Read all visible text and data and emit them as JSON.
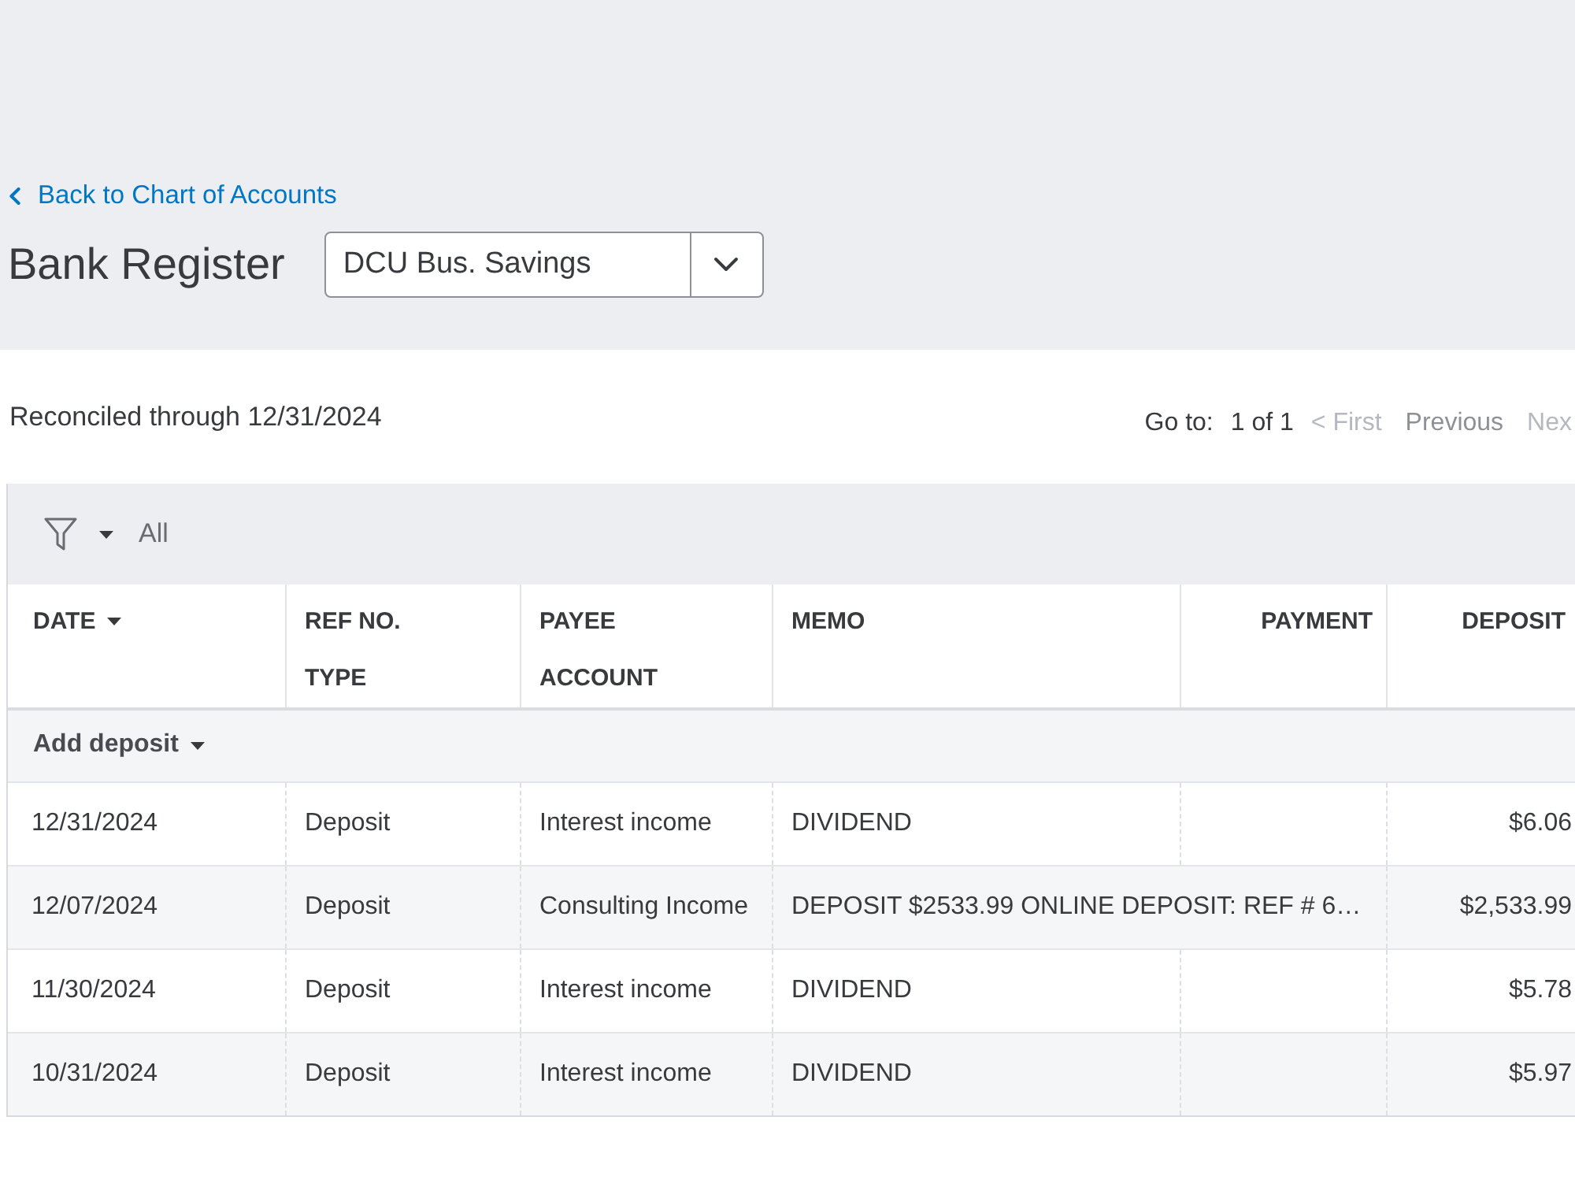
{
  "back_link": {
    "label": "Back to Chart of Accounts"
  },
  "title": "Bank Register",
  "account_select": {
    "value": "DCU Bus. Savings"
  },
  "reconciled": "Reconciled through 12/31/2024",
  "pagination": {
    "goto_label": "Go to:",
    "page": "1 of 1",
    "links": [
      {
        "label": "< First",
        "disabled": true
      },
      {
        "label": "Previous",
        "disabled": false
      },
      {
        "label": "Nex",
        "disabled": true
      }
    ]
  },
  "filter": {
    "value": "All"
  },
  "table": {
    "columns": [
      {
        "lines": [
          "DATE"
        ],
        "kind": "text",
        "sorted": true
      },
      {
        "lines": [
          "REF NO.",
          "TYPE"
        ],
        "kind": "text",
        "sorted": false
      },
      {
        "lines": [
          "PAYEE",
          "ACCOUNT"
        ],
        "kind": "text",
        "sorted": false
      },
      {
        "lines": [
          "MEMO"
        ],
        "kind": "text",
        "sorted": false
      },
      {
        "lines": [
          "PAYMENT"
        ],
        "kind": "amount",
        "sorted": false
      },
      {
        "lines": [
          "DEPOSIT"
        ],
        "kind": "amount",
        "sorted": false
      }
    ],
    "add_button": {
      "label": "Add deposit"
    },
    "rows": [
      {
        "date": "12/31/2024",
        "type": "Deposit",
        "account": "Interest income",
        "memo": "DIVIDEND",
        "deposit": "$6.06"
      },
      {
        "date": "12/07/2024",
        "type": "Deposit",
        "account": "Consulting Income",
        "memo": "DEPOSIT $2533.99 ONLINE DEPOSIT: REF # 6…",
        "deposit": "$2,533.99"
      },
      {
        "date": "11/30/2024",
        "type": "Deposit",
        "account": "Interest income",
        "memo": "DIVIDEND",
        "deposit": "$5.78"
      },
      {
        "date": "10/31/2024",
        "type": "Deposit",
        "account": "Interest income",
        "memo": "DIVIDEND",
        "deposit": "$5.97"
      }
    ]
  }
}
